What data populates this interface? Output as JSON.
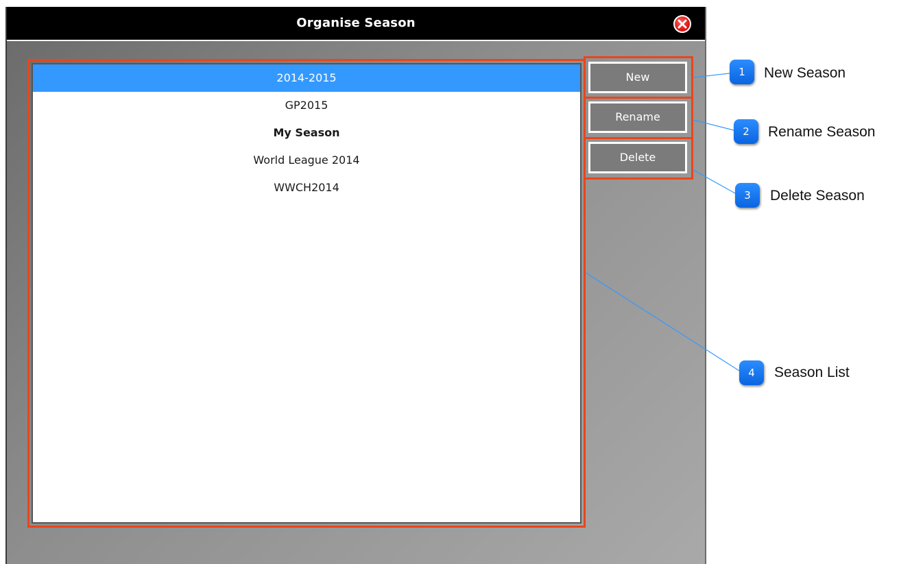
{
  "window": {
    "title": "Organise Season",
    "close_icon": "close-icon"
  },
  "seasons": [
    {
      "label": "2014-2015",
      "selected": true,
      "bold": false
    },
    {
      "label": "GP2015",
      "selected": false,
      "bold": false
    },
    {
      "label": "My Season",
      "selected": false,
      "bold": true
    },
    {
      "label": "World League 2014",
      "selected": false,
      "bold": false
    },
    {
      "label": "WWCH2014",
      "selected": false,
      "bold": false
    }
  ],
  "buttons": {
    "new_label": "New",
    "rename_label": "Rename",
    "delete_label": "Delete"
  },
  "callouts": [
    {
      "number": "1",
      "label": "New Season"
    },
    {
      "number": "2",
      "label": "Rename Season"
    },
    {
      "number": "3",
      "label": "Delete Season"
    },
    {
      "number": "4",
      "label": "Season List"
    }
  ],
  "colors": {
    "highlight": "#e8461c",
    "selection": "#3399ff",
    "badge": "#0a64e0",
    "callout_line": "#3399ff"
  }
}
